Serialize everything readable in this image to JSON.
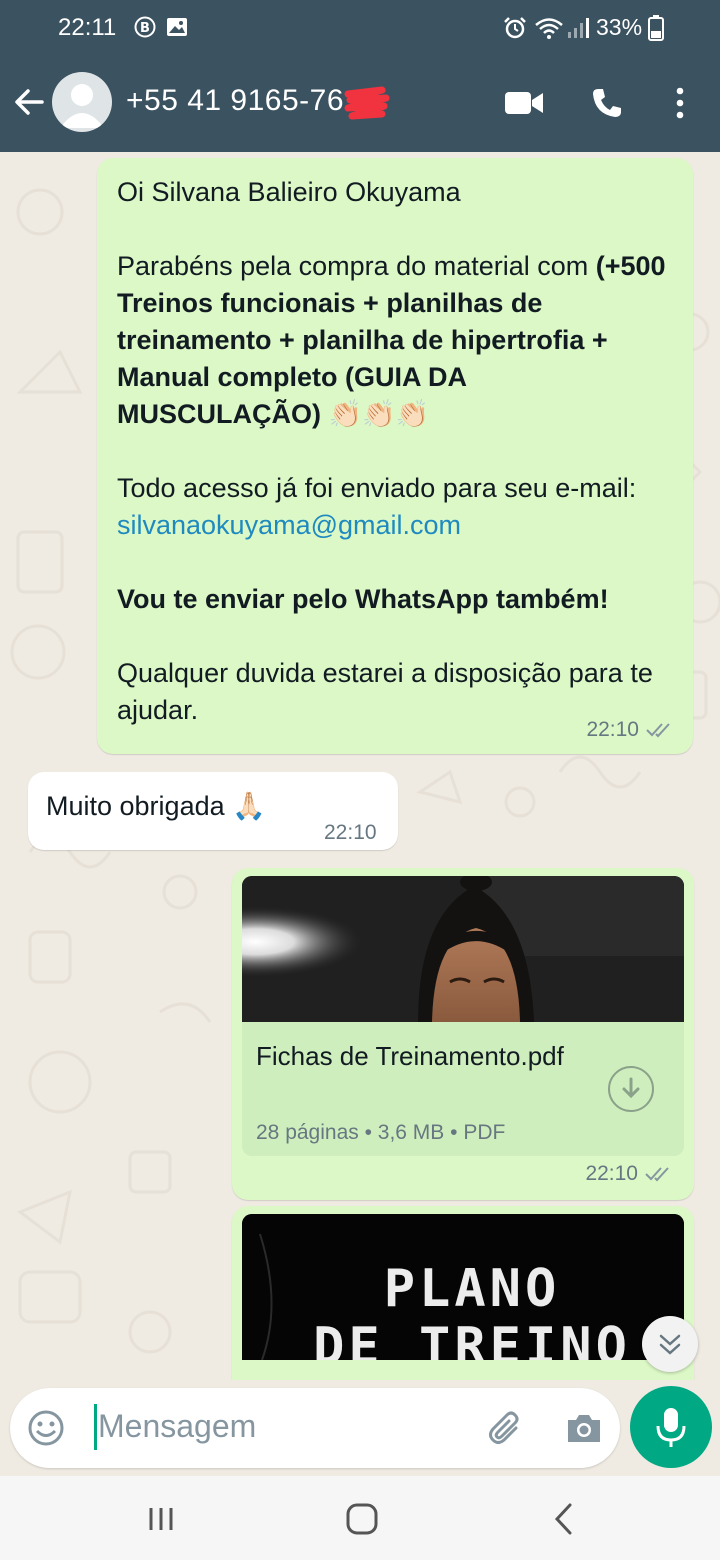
{
  "status_bar": {
    "time": "22:11",
    "battery": "33%"
  },
  "header": {
    "contact": "+55 41 9165-76"
  },
  "messages": {
    "m1": {
      "greeting": "Oi Silvana Balieiro Okuyama",
      "p2_prefix": "Parabéns pela compra do material com ",
      "p2_bold": "(+500 Treinos funcionais + planilhas de treinamento + planilha de hipertrofia + Manual completo (GUIA DA MUSCULAÇÃO)",
      "p2_emoji": " 👏🏻👏🏻👏🏻",
      "p3_prefix": "Todo acesso já foi enviado para seu e-mail: ",
      "p3_email": "silvanaokuyama@gmail.com",
      "p4_bold": "Vou te enviar pelo WhatsApp também!",
      "p5": "Qualquer duvida estarei a disposição para te ajudar.",
      "time": "22:10"
    },
    "m2": {
      "text": "Muito obrigada 🙏🏻",
      "time": "22:10"
    },
    "m3": {
      "doc_name": "Fichas de Treinamento.pdf",
      "doc_meta": "28 páginas • 3,6 MB • PDF",
      "time": "22:10"
    },
    "m4": {
      "thumb_text_line1": "PLANO",
      "thumb_text_line2": "DE TREINO"
    }
  },
  "input": {
    "placeholder": "Mensagem"
  },
  "colors": {
    "header_bg": "#3b5260",
    "outgoing_bubble": "#dcf8c6",
    "incoming_bubble": "#ffffff",
    "accent": "#00a884",
    "link": "#1f8ac0"
  },
  "icons": [
    "back-arrow-icon",
    "avatar-icon",
    "video-call-icon",
    "phone-icon",
    "more-options-icon",
    "double-check-icon",
    "download-icon",
    "chevron-double-down-icon",
    "emoji-icon",
    "attach-icon",
    "camera-icon",
    "mic-icon"
  ]
}
